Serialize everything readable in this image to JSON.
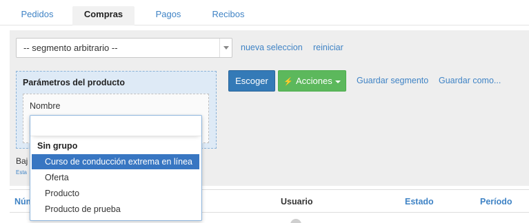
{
  "tabs": [
    {
      "label": "Pedidos",
      "active": false
    },
    {
      "label": "Compras",
      "active": true
    },
    {
      "label": "Pagos",
      "active": false
    },
    {
      "label": "Recibos",
      "active": false
    }
  ],
  "segment": {
    "selected": "-- segmento arbitrario --",
    "new_link": "nueva seleccion",
    "reset_link": "reiniciar"
  },
  "params": {
    "title": "Parámetros del producto",
    "field_label": "Nombre"
  },
  "actions": {
    "choose_label": "Escoger",
    "actions_label": "Acciones",
    "save_segment": "Guardar segmento",
    "save_as": "Guardar como..."
  },
  "below": {
    "text": "Baj",
    "small": "Esta"
  },
  "table": {
    "headers": [
      "Núm",
      "Usuario",
      "Estado",
      "Período"
    ]
  },
  "dropdown": {
    "group": "Sin grupo",
    "options": [
      "Curso de conducción extrema en línea",
      "Oferta",
      "Producto",
      "Producto de prueba"
    ],
    "highlighted_index": 0
  },
  "colors": {
    "link": "#3f83c5",
    "primary": "#347ab7",
    "success": "#5cb85c",
    "highlight": "#3876c2",
    "params_bg": "#deeaf6"
  },
  "icons": [
    "chevron-down-icon",
    "bolt-icon",
    "caret-down-icon",
    "spinner-icon"
  ]
}
